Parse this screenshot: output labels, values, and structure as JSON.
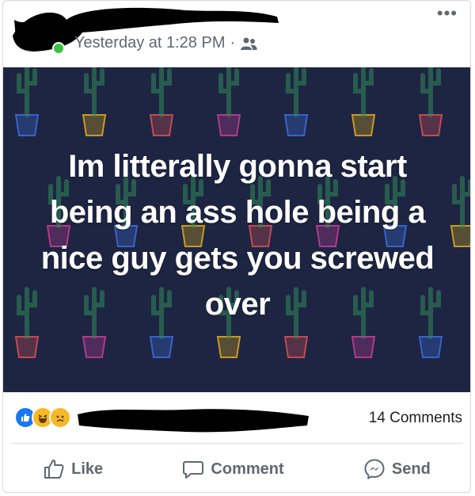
{
  "header": {
    "timestamp": "Yesterday at 1:28 PM",
    "separator": "·",
    "audience_icon": "friends-icon",
    "more_icon": "more-horizontal-icon",
    "more_label": "•••"
  },
  "post": {
    "text": "Im litterally gonna start being an ass hole being a nice guy gets you screwed over",
    "background_color": "#1d2542"
  },
  "reactions": {
    "icons": [
      "like-reaction-icon",
      "haha-reaction-icon",
      "sad-reaction-icon"
    ],
    "comments_count": "14 Comments"
  },
  "actions": {
    "like_label": "Like",
    "comment_label": "Comment",
    "send_label": "Send"
  }
}
